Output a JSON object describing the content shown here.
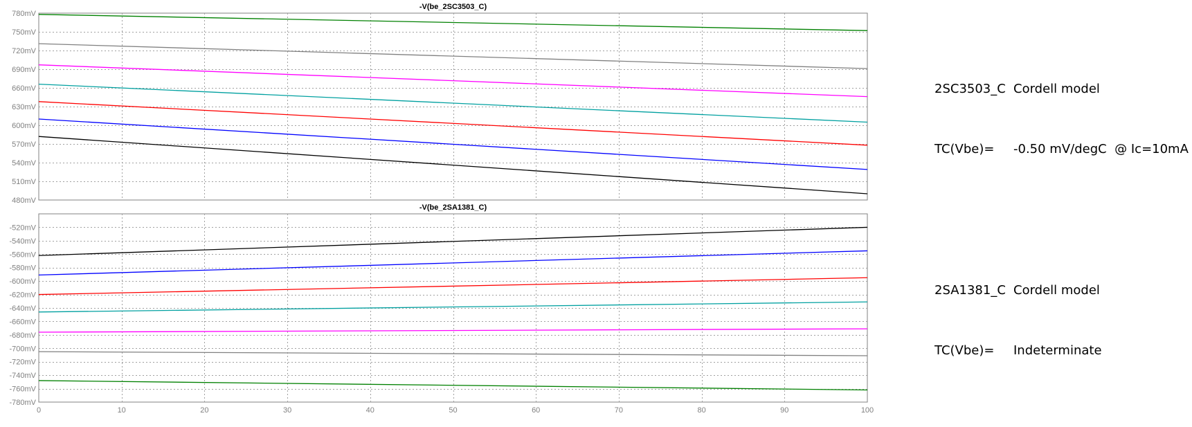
{
  "chart_data": [
    {
      "type": "line",
      "title": "-V(be_2SC3503_C)",
      "x": [
        0,
        100
      ],
      "xticks": [
        0,
        10,
        20,
        30,
        40,
        50,
        60,
        70,
        80,
        90,
        100
      ],
      "xlim": [
        0,
        100
      ],
      "ylim": [
        480,
        780
      ],
      "yticks": [
        {
          "v": 780,
          "label": "780mV"
        },
        {
          "v": 750,
          "label": "750mV"
        },
        {
          "v": 720,
          "label": "720mV"
        },
        {
          "v": 690,
          "label": "690mV"
        },
        {
          "v": 660,
          "label": "660mV"
        },
        {
          "v": 630,
          "label": "630mV"
        },
        {
          "v": 600,
          "label": "600mV"
        },
        {
          "v": 570,
          "label": "570mV"
        },
        {
          "v": 540,
          "label": "540mV"
        },
        {
          "v": 510,
          "label": "510mV"
        },
        {
          "v": 480,
          "label": "480mV"
        }
      ],
      "grid": true,
      "series": [
        {
          "color": "#008000",
          "values": [
            778,
            752
          ]
        },
        {
          "color": "#808080",
          "values": [
            731,
            691
          ]
        },
        {
          "color": "#ff00ff",
          "values": [
            697,
            646
          ]
        },
        {
          "color": "#00a0a0",
          "values": [
            666,
            605
          ]
        },
        {
          "color": "#ff0000",
          "values": [
            638,
            568
          ]
        },
        {
          "color": "#0000ff",
          "values": [
            610,
            529
          ]
        },
        {
          "color": "#000000",
          "values": [
            582,
            490
          ]
        }
      ]
    },
    {
      "type": "line",
      "title": "-V(be_2SA1381_C)",
      "x": [
        0,
        100
      ],
      "xticks": [
        0,
        10,
        20,
        30,
        40,
        50,
        60,
        70,
        80,
        90,
        100
      ],
      "xlim": [
        0,
        100
      ],
      "ylim": [
        -780,
        -500
      ],
      "yticks": [
        {
          "v": -520,
          "label": "-520mV"
        },
        {
          "v": -540,
          "label": "-540mV"
        },
        {
          "v": -560,
          "label": "-560mV"
        },
        {
          "v": -580,
          "label": "-580mV"
        },
        {
          "v": -600,
          "label": "-600mV"
        },
        {
          "v": -620,
          "label": "-620mV"
        },
        {
          "v": -640,
          "label": "-640mV"
        },
        {
          "v": -660,
          "label": "-660mV"
        },
        {
          "v": -680,
          "label": "-680mV"
        },
        {
          "v": -700,
          "label": "-700mV"
        },
        {
          "v": -720,
          "label": "-720mV"
        },
        {
          "v": -740,
          "label": "-740mV"
        },
        {
          "v": -760,
          "label": "-760mV"
        },
        {
          "v": -780,
          "label": "-780mV"
        }
      ],
      "grid": true,
      "series": [
        {
          "color": "#000000",
          "values": [
            -562,
            -520
          ]
        },
        {
          "color": "#0000ff",
          "values": [
            -591,
            -555
          ]
        },
        {
          "color": "#ff0000",
          "values": [
            -620,
            -595
          ]
        },
        {
          "color": "#00a0a0",
          "values": [
            -646,
            -631
          ]
        },
        {
          "color": "#ff00ff",
          "values": [
            -676,
            -671
          ]
        },
        {
          "color": "#808080",
          "values": [
            -705,
            -711
          ]
        },
        {
          "color": "#008000",
          "values": [
            -748,
            -762
          ]
        }
      ]
    }
  ],
  "annotations": {
    "top": {
      "line1_key": "2SC3503_C",
      "line1_val": "Cordell model",
      "line2_key": "TC(Vbe)=",
      "line2_val": "-0.50 mV/degC  @ Ic=10mA"
    },
    "bottom": {
      "line1_key": "2SA1381_C",
      "line1_val": "Cordell model",
      "line2_key": "TC(Vbe)=",
      "line2_val": "Indeterminate"
    }
  }
}
